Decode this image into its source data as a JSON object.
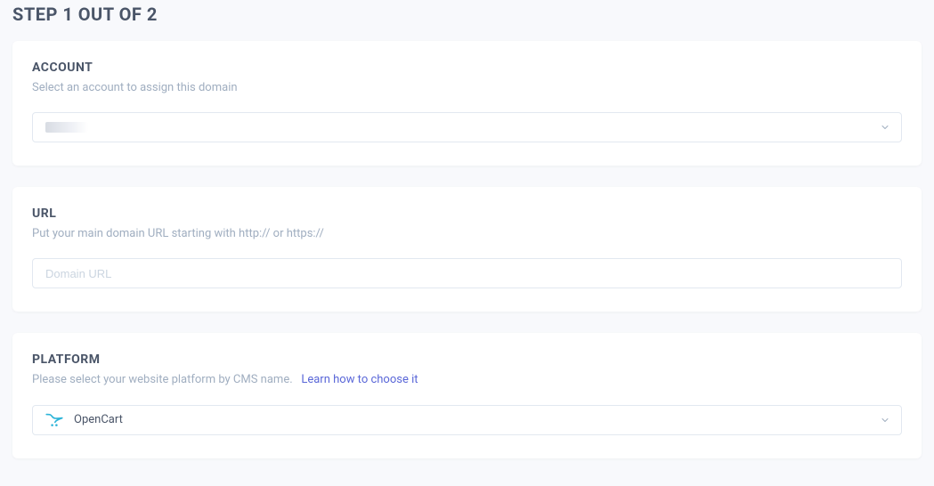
{
  "step_title": "STEP 1 OUT OF 2",
  "account": {
    "heading": "ACCOUNT",
    "description": "Select an account to assign this domain",
    "selected": ""
  },
  "url": {
    "heading": "URL",
    "description": "Put your main domain URL starting with http:// or https://",
    "placeholder": "Domain URL",
    "value": ""
  },
  "platform": {
    "heading": "PLATFORM",
    "description_prefix": "Please select your website platform by CMS name.",
    "learn_link": "Learn how to choose it",
    "selected": "OpenCart"
  }
}
